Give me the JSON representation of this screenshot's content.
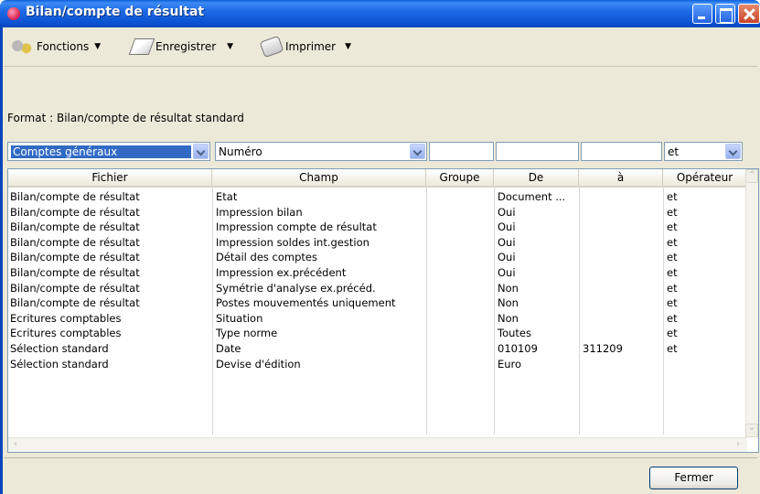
{
  "window": {
    "title": "Bilan/compte de résultat"
  },
  "toolbar": {
    "fonctions": "Fonctions",
    "enregistrer": "Enregistrer",
    "imprimer": "Imprimer"
  },
  "format_label": "Format : Bilan/compte de résultat standard",
  "filters": {
    "fichier": "Comptes généraux",
    "champ": "Numéro",
    "groupe": "",
    "de": "",
    "a": "",
    "operateur": "et"
  },
  "columns": [
    "Fichier",
    "Champ",
    "Groupe",
    "De",
    "à",
    "Opérateur"
  ],
  "rows": [
    [
      "Bilan/compte de résultat",
      "Etat",
      "",
      "Document ...",
      "",
      "et"
    ],
    [
      "Bilan/compte de résultat",
      "Impression bilan",
      "",
      "Oui",
      "",
      "et"
    ],
    [
      "Bilan/compte de résultat",
      "Impression compte de résultat",
      "",
      "Oui",
      "",
      "et"
    ],
    [
      "Bilan/compte de résultat",
      "Impression soldes int.gestion",
      "",
      "Oui",
      "",
      "et"
    ],
    [
      "Bilan/compte de résultat",
      "Détail des comptes",
      "",
      "Oui",
      "",
      "et"
    ],
    [
      "Bilan/compte de résultat",
      "Impression ex.précédent",
      "",
      "Oui",
      "",
      "et"
    ],
    [
      "Bilan/compte de résultat",
      "Symétrie d'analyse ex.précéd.",
      "",
      "Non",
      "",
      "et"
    ],
    [
      "Bilan/compte de résultat",
      "Postes mouvementés uniquement",
      "",
      "Non",
      "",
      "et"
    ],
    [
      "Ecritures comptables",
      "Situation",
      "",
      "Non",
      "",
      "et"
    ],
    [
      "Ecritures comptables",
      "Type norme",
      "",
      "Toutes",
      "",
      "et"
    ],
    [
      "Sélection standard",
      "Date",
      "",
      "010109",
      "311209",
      "et"
    ],
    [
      "Sélection standard",
      "Devise d'édition",
      "",
      "Euro",
      "",
      ""
    ]
  ],
  "buttons": {
    "fermer": "Fermer"
  }
}
